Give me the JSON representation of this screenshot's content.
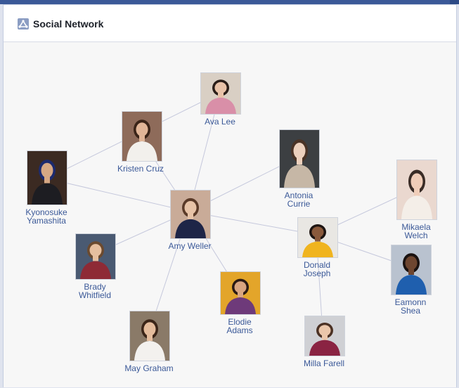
{
  "panel": {
    "title": "Social Network",
    "icon": "network-app-icon"
  },
  "colors": {
    "accent": "#3b5998",
    "label": "#3b5998",
    "edge": "#c5c8dc",
    "canvas": "#f7f7f7"
  },
  "network": {
    "nodes": [
      {
        "id": "ava",
        "name": "Ava Lee",
        "lines": [
          "Ava Lee"
        ],
        "photo": {
          "bg": "#d9cfc4",
          "shirt": "#d98fa8",
          "hair": "#2a1d18",
          "skin": "#e8c2a8"
        }
      },
      {
        "id": "kristen",
        "name": "Kristen Cruz",
        "lines": [
          "Kristen Cruz"
        ],
        "photo": {
          "bg": "#8e6b5a",
          "shirt": "#f2f0ec",
          "hair": "#3a2418",
          "skin": "#e0b597"
        }
      },
      {
        "id": "kyonosuke",
        "name": "Kyonosuke Yamashita",
        "lines": [
          "Kyonosuke",
          "Yamashita"
        ],
        "photo": {
          "bg": "#3b2a22",
          "shirt": "#1d1d22",
          "hair": "#1c2a6e",
          "skin": "#d6a884"
        }
      },
      {
        "id": "antonia",
        "name": "Antonia Currie",
        "lines": [
          "Antonia",
          "Currie"
        ],
        "photo": {
          "bg": "#3c3f42",
          "shirt": "#c6b7a6",
          "hair": "#4a3326",
          "skin": "#ecd0bd"
        }
      },
      {
        "id": "amy",
        "name": "Amy Weller",
        "lines": [
          "Amy Weller"
        ],
        "photo": {
          "bg": "#c9ab98",
          "shirt": "#1e2547",
          "hair": "#5a3a28",
          "skin": "#e7c3a7"
        }
      },
      {
        "id": "mikaela",
        "name": "Mikaela Welch",
        "lines": [
          "Mikaela",
          "Welch"
        ],
        "photo": {
          "bg": "#ead8cf",
          "shirt": "#f4eee8",
          "hair": "#3a2c26",
          "skin": "#f0cdb8"
        }
      },
      {
        "id": "donald",
        "name": "Donald Joseph",
        "lines": [
          "Donald",
          "Joseph"
        ],
        "photo": {
          "bg": "#e9e7e3",
          "shirt": "#f0b41e",
          "hair": "#1e1512",
          "skin": "#8a5a3c"
        }
      },
      {
        "id": "brady",
        "name": "Brady Whitfield",
        "lines": [
          "Brady",
          "Whitfield"
        ],
        "photo": {
          "bg": "#4a5a72",
          "shirt": "#8e2a35",
          "hair": "#6b4a2f",
          "skin": "#e6bf9f"
        }
      },
      {
        "id": "eamonn",
        "name": "Eamonn Shea",
        "lines": [
          "Eamonn",
          "Shea"
        ],
        "photo": {
          "bg": "#b9c2cf",
          "shirt": "#1f5fae",
          "hair": "#1a1210",
          "skin": "#6e4630"
        }
      },
      {
        "id": "elodie",
        "name": "Elodie Adams",
        "lines": [
          "Elodie",
          "Adams"
        ],
        "photo": {
          "bg": "#e3a52a",
          "shirt": "#6e3a7a",
          "hair": "#2b1a14",
          "skin": "#d9a580"
        }
      },
      {
        "id": "may",
        "name": "May Graham",
        "lines": [
          "May Graham"
        ],
        "photo": {
          "bg": "#8a7a68",
          "shirt": "#f3f1ee",
          "hair": "#3b2518",
          "skin": "#e4bc9c"
        }
      },
      {
        "id": "milla",
        "name": "Milla Farell",
        "lines": [
          "Milla Farell"
        ],
        "photo": {
          "bg": "#cfd0d4",
          "shirt": "#8a2342",
          "hair": "#4b3124",
          "skin": "#ebc7ab"
        }
      }
    ],
    "edges": [
      [
        "kyonosuke",
        "ava"
      ],
      [
        "kyonosuke",
        "amy"
      ],
      [
        "kristen",
        "amy"
      ],
      [
        "ava",
        "amy"
      ],
      [
        "antonia",
        "amy"
      ],
      [
        "brady",
        "amy"
      ],
      [
        "may",
        "amy"
      ],
      [
        "elodie",
        "amy"
      ],
      [
        "amy",
        "donald"
      ],
      [
        "donald",
        "mikaela"
      ],
      [
        "donald",
        "eamonn"
      ],
      [
        "donald",
        "milla"
      ]
    ]
  }
}
